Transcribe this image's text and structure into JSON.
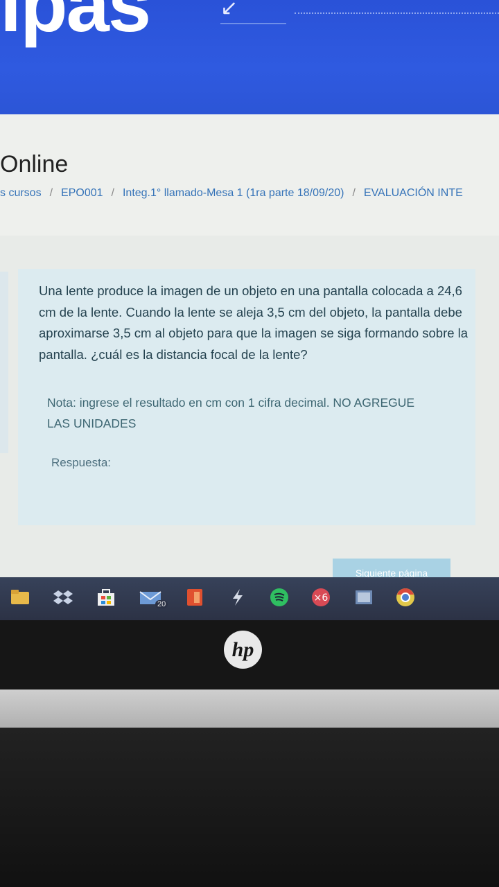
{
  "banner": {
    "logo_text": "ipas",
    "arrow_icon": "↙"
  },
  "header": {
    "site_name": "Online"
  },
  "breadcrumb": {
    "items": [
      "s cursos",
      "EPO001",
      "Integ.1° llamado-Mesa 1 (1ra parte 18/09/20)",
      "EVALUACIÓN INTE"
    ],
    "separator": "/"
  },
  "question": {
    "text": "Una lente produce la imagen de un objeto en una pantalla colocada  a 24,6 cm de la lente. Cuando la lente se aleja 3,5 cm del objeto, la pantalla debe aproximarse 3,5 cm al objeto para que la imagen se siga formando sobre la pantalla. ¿cuál es la distancia focal de la lente?",
    "note": "Nota: ingrese el resultado en cm con 1 cifra decimal. NO AGREGUE LAS UNIDADES",
    "answer_label": "Respuesta:",
    "answer_value": ""
  },
  "navigation": {
    "next_label": "Siguiente página"
  },
  "taskbar": {
    "icons": [
      "file-explorer-icon",
      "dropbox-icon",
      "store-icon",
      "mail-icon",
      "office-icon",
      "app-icon",
      "spotify-icon",
      "app-red-icon",
      "photos-icon",
      "chrome-icon"
    ],
    "mail_badge": "20"
  },
  "hardware": {
    "brand_logo": "hp"
  },
  "colors": {
    "banner": "#2f5ae0",
    "link": "#3573b8",
    "question_bg": "#dcebf0",
    "taskbar": "#2c3245"
  }
}
